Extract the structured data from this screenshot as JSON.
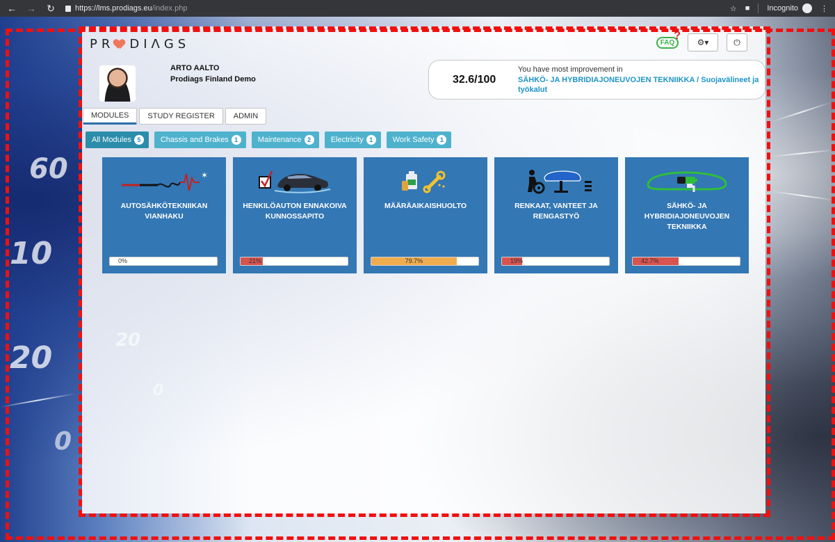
{
  "browser": {
    "url_host": "https://lms.prodiags.eu",
    "url_path": "/index.php",
    "mode_label": "Incognito"
  },
  "scene": {
    "gauge_numbers": [
      "60",
      "10",
      "20",
      "20",
      "0",
      "0"
    ]
  },
  "header": {
    "logo_text": "PRODIAGS",
    "faq_label": "FAQ",
    "faq_mark": "?"
  },
  "user": {
    "name": "ARTO AALTO",
    "organization": "Prodiags Finland Demo"
  },
  "score": {
    "value": "32.6/100",
    "hint": "You have most improvement in",
    "improvement_link": "SÄHKÖ- JA HYBRIDIAJONEUVOJEN TEKNIIKKA / Suojavälineet ja työkalut"
  },
  "tabs": [
    {
      "label": "MODULES",
      "active": true
    },
    {
      "label": "STUDY REGISTER",
      "active": false
    },
    {
      "label": "ADMIN",
      "active": false
    }
  ],
  "filters": [
    {
      "label": "All Modules",
      "count": "5",
      "active": true
    },
    {
      "label": "Chassis and Brakes",
      "count": "1",
      "active": false
    },
    {
      "label": "Maintenance",
      "count": "2",
      "active": false
    },
    {
      "label": "Electricity",
      "count": "1",
      "active": false
    },
    {
      "label": "Work Safety",
      "count": "1",
      "active": false
    }
  ],
  "modules": [
    {
      "title": "AUTOSÄHKÖTEKNIIKAN VIANHAKU",
      "progress_text": "0%",
      "progress": 0,
      "bar_color": "#ffffff",
      "icon": "multimeter-probe-icon"
    },
    {
      "title": "HENKILÖAUTON ENNAKOIVA KUNNOSSAPITO",
      "progress_text": "21%",
      "progress": 0.21,
      "bar_color": "#d9534f",
      "icon": "car-checkbox-icon"
    },
    {
      "title": "MÄÄRÄAIKAISHUOLTO",
      "progress_text": "79.7%",
      "progress": 0.797,
      "bar_color": "#f0ad4e",
      "icon": "oil-wrench-icon"
    },
    {
      "title": "RENKAAT, VANTEET JA RENGASTYÖ",
      "progress_text": "19%",
      "progress": 0.19,
      "bar_color": "#d9534f",
      "icon": "tire-lift-icon"
    },
    {
      "title": "SÄHKÖ- JA HYBRIDIAJONEUVOJEN TEKNIIKKA",
      "progress_text": "42.7%",
      "progress": 0.427,
      "bar_color": "#d9534f",
      "icon": "electric-car-icon"
    }
  ],
  "colors": {
    "module_bg": "#3377b5",
    "filter_bg": "#4fb2cd",
    "filter_active_bg": "#2c8dab",
    "link_blue": "#1d94c8",
    "annotation_red": "#f01010"
  }
}
